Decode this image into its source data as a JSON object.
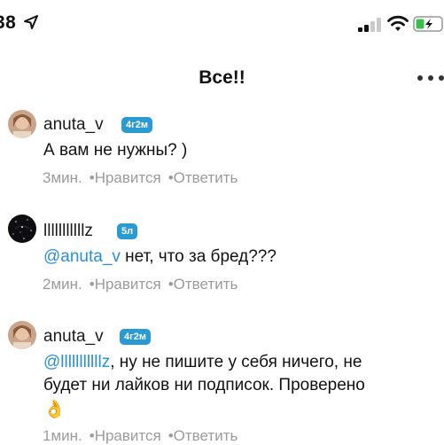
{
  "status_bar": {
    "time": "38",
    "icons": [
      "location-arrow-icon",
      "signal-icon",
      "wifi-icon",
      "battery-icon"
    ]
  },
  "header": {
    "title": "Все!!",
    "more_icon": "ellipsis-icon"
  },
  "comments": [
    {
      "username": "anuta_v",
      "badge": "4г2м",
      "mention": "",
      "text": "А вам не нужны? )",
      "time": "3мин.",
      "like": "Нравится",
      "reply": "Ответить"
    },
    {
      "username": "lllllllllllz",
      "badge": "5л",
      "mention": "@anuta_v",
      "text": " нет, что за бред???",
      "time": "2мин.",
      "like": "Нравится",
      "reply": "Ответить"
    },
    {
      "username": "anuta_v",
      "badge": "4г2м",
      "mention": "@lllllllllllz",
      "text_line1": ", ну не пишите у себя ничего, не",
      "text_line2": "будет ни лайков ни подписок. Проверено",
      "emoji": "👌",
      "time": "1мин.",
      "like": "Нравится",
      "reply": "Ответить"
    }
  ],
  "separator": "•",
  "colors": {
    "badge": "#2a9ad3",
    "mention": "#2a8fd6",
    "meta": "#9b9b9b"
  }
}
